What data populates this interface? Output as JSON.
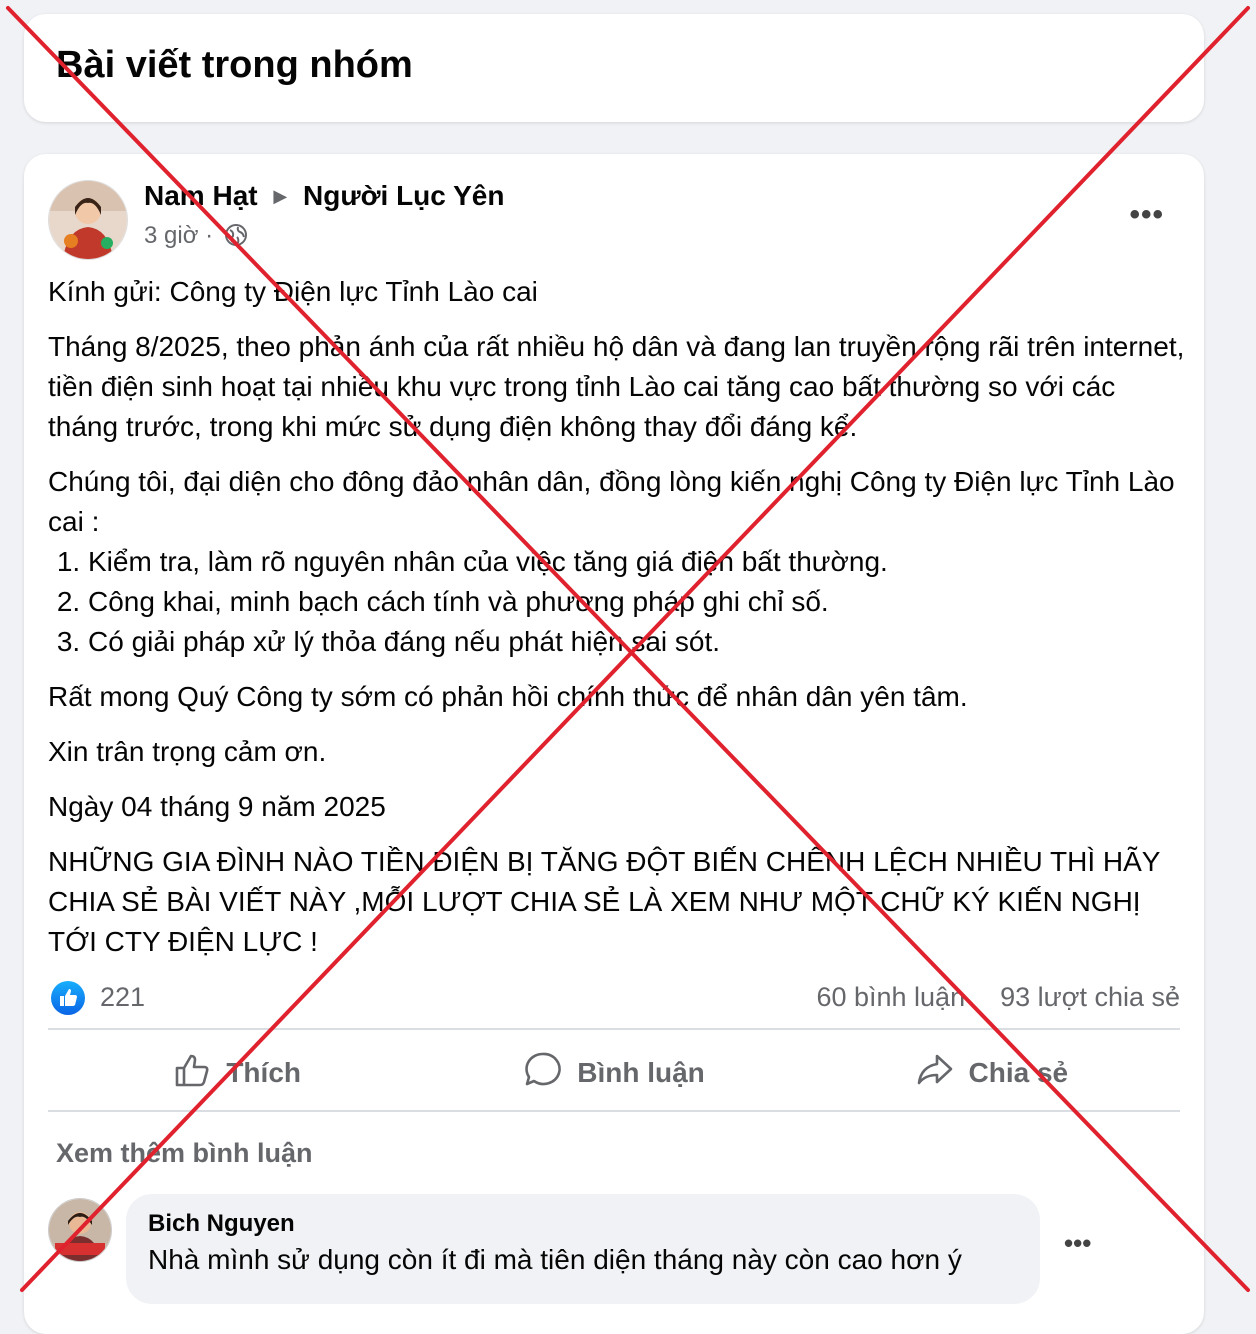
{
  "header": {
    "title": "Bài viết trong nhóm"
  },
  "post": {
    "author": "Nam Hạt",
    "group": "Người Lục Yên",
    "time": "3 giờ",
    "time_sep": "·",
    "more": "•••",
    "greeting": "Kính gửi: Công ty Điện lực Tỉnh Lào cai",
    "para1": "Tháng 8/2025, theo phản ánh của rất nhiều hộ dân và đang lan truyền rộng rãi trên internet, tiền điện sinh hoạt tại nhiều khu vực trong tỉnh Lào cai tăng cao bất thường so với các tháng trước, trong khi mức sử dụng điện không thay đổi đáng kể.",
    "para2": "Chúng tôi, đại diện cho đông đảo nhân dân, đồng lòng kiến nghị Công ty Điện lực Tỉnh Lào cai :",
    "items": [
      "Kiểm tra, làm rõ nguyên nhân của việc tăng giá điện bất thường.",
      "Công khai, minh bạch cách tính và phương pháp ghi chỉ số.",
      "Có giải pháp xử lý thỏa đáng nếu phát hiện sai sót."
    ],
    "para3": "Rất mong Quý Công ty sớm có phản hồi chính thức để nhân dân yên tâm.",
    "para4": "Xin trân trọng cảm ơn.",
    "date": "Ngày 04 tháng 9 năm 2025",
    "para5": "NHỮNG GIA ĐÌNH NÀO TIỀN ĐIỆN BỊ TĂNG ĐỘT BIẾN CHÊNH LỆCH NHIỀU THÌ HÃY CHIA SẺ BÀI VIẾT NÀY ,MỖI LƯỢT CHIA SẺ LÀ XEM NHƯ MỘT CHỮ KÝ KIẾN NGHỊ TỚI CTY ĐIỆN LỰC !",
    "likes": "221",
    "comments": "60 bình luận",
    "shares": "93 lượt chia sẻ"
  },
  "actions": {
    "like": "Thích",
    "comment": "Bình luận",
    "share": "Chia sẻ"
  },
  "comments": {
    "see_more": "Xem thêm bình luận",
    "first": {
      "name": "Bich Nguyen",
      "text": "Nhà mình sử dụng còn ít đi mà tiên diện tháng này còn cao hơn ý",
      "more": "•••"
    }
  },
  "colors": {
    "accent": "#1877f2",
    "cross": "#e0222e",
    "background": "#f0f2f5"
  }
}
